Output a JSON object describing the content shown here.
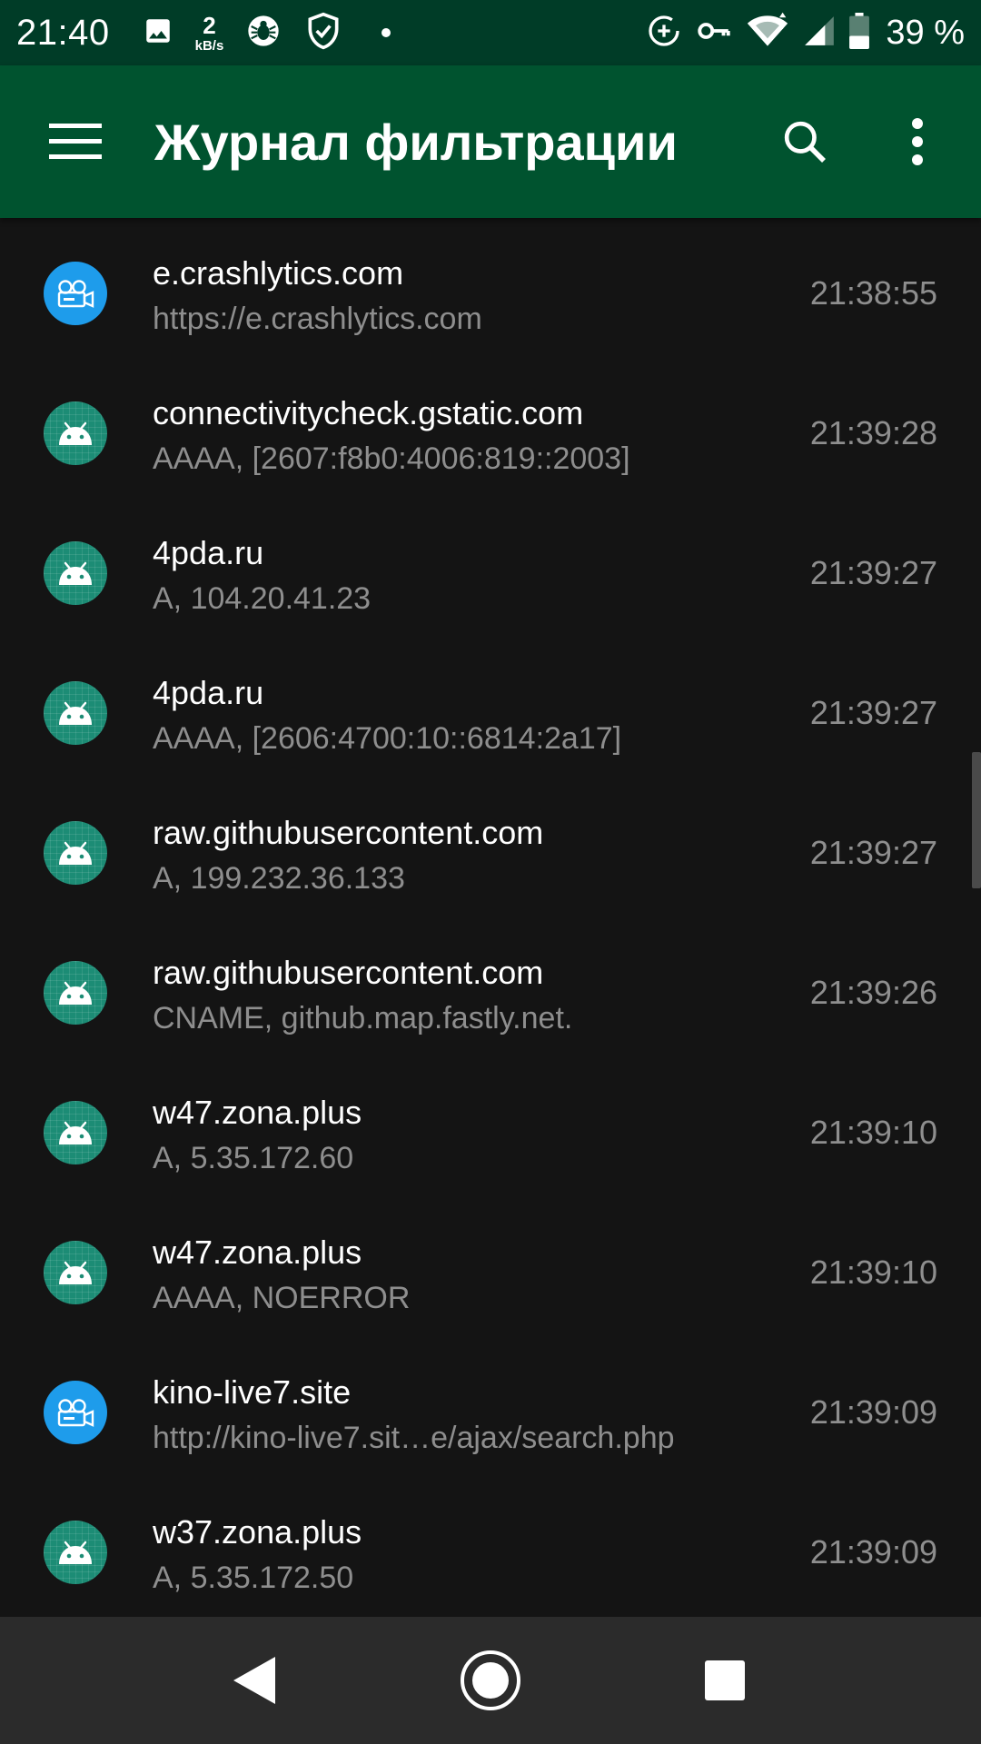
{
  "status_bar": {
    "time": "21:40",
    "speed_value": "2",
    "speed_unit": "kB/s",
    "battery_percent": "39 %",
    "icons": [
      "image-icon",
      "speed-icon",
      "dr-web-icon",
      "shield-check-icon",
      "dot-icon",
      "data-saver-icon",
      "vpn-key-icon",
      "wifi-icon",
      "signal-icon",
      "battery-icon"
    ]
  },
  "app_bar": {
    "title": "Журнал фильтрации",
    "icons": [
      "menu-icon",
      "search-icon",
      "more-vert-icon"
    ]
  },
  "colors": {
    "status_bar_bg": "#003c27",
    "app_bar_bg": "#00532f",
    "list_bg": "#141414",
    "android_icon_bg": "#1c8c75",
    "camera_icon_bg": "#1e9ceb",
    "primary_text": "#ffffff",
    "secondary_text": "#8e8e8e",
    "nav_bar_bg": "#2b2b2b"
  },
  "log": [
    {
      "icon": "camera",
      "domain": "e.crashlytics.com",
      "detail": "https://e.crashlytics.com",
      "time": "21:38:55"
    },
    {
      "icon": "android",
      "domain": "connectivitycheck.gstatic.com",
      "detail": "AAAA, [2607:f8b0:4006:819::2003]",
      "time": "21:39:28"
    },
    {
      "icon": "android",
      "domain": "4pda.ru",
      "detail": "A, 104.20.41.23",
      "time": "21:39:27"
    },
    {
      "icon": "android",
      "domain": "4pda.ru",
      "detail": "AAAA, [2606:4700:10::6814:2a17]",
      "time": "21:39:27"
    },
    {
      "icon": "android",
      "domain": "raw.githubusercontent.com",
      "detail": "A, 199.232.36.133",
      "time": "21:39:27"
    },
    {
      "icon": "android",
      "domain": "raw.githubusercontent.com",
      "detail": "CNAME, github.map.fastly.net.",
      "time": "21:39:26"
    },
    {
      "icon": "android",
      "domain": "w47.zona.plus",
      "detail": "A, 5.35.172.60",
      "time": "21:39:10"
    },
    {
      "icon": "android",
      "domain": "w47.zona.plus",
      "detail": "AAAA, NOERROR",
      "time": "21:39:10"
    },
    {
      "icon": "camera",
      "domain": "kino-live7.site",
      "detail": "http://kino-live7.sit…e/ajax/search.php",
      "time": "21:39:09"
    },
    {
      "icon": "android",
      "domain": "w37.zona.plus",
      "detail": "A, 5.35.172.50",
      "time": "21:39:09"
    }
  ],
  "nav_bar": {
    "icons": [
      "back-icon",
      "home-icon",
      "recents-icon"
    ]
  }
}
